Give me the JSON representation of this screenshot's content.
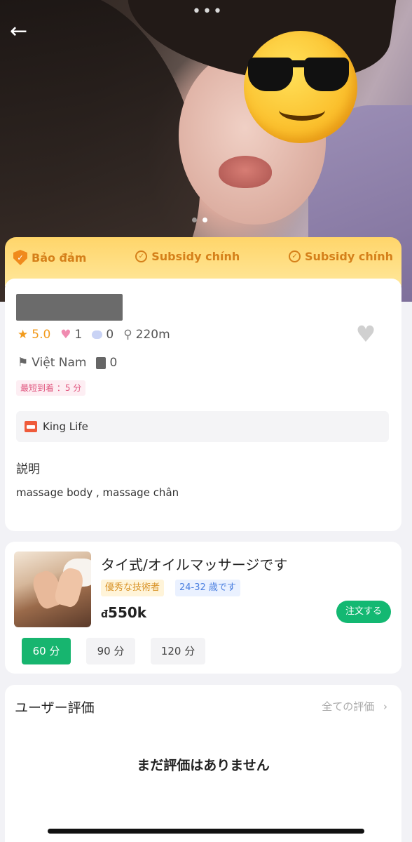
{
  "nav": {
    "back_icon": "←",
    "more_icon": "•••"
  },
  "guarantee": {
    "items": [
      {
        "label": "Bảo đảm"
      },
      {
        "label": "Subsidy chính"
      },
      {
        "label": "Subsidy chính"
      }
    ]
  },
  "profile": {
    "rating": "5.0",
    "likes": "1",
    "comments": "0",
    "distance": "220m",
    "country": "Việt Nam",
    "orders": "0",
    "arrival_tag": "最短到着 ：5 分",
    "shop_name": "King Life",
    "desc_title": "説明",
    "desc_text": "massage body , massage chân"
  },
  "service": {
    "title": "タイ式/オイルマッサージです",
    "tag_quality": "優秀な技術者",
    "tag_age": "24-32 歳です",
    "price_prefix": "đ",
    "price_value": "550k",
    "order_label": "注文する",
    "durations": [
      "60 分",
      "90 分",
      "120 分"
    ],
    "selected_duration": "60 分"
  },
  "reviews": {
    "title": "ユーザー評価",
    "all_label": "全ての評価",
    "empty_text": "まだ評価はありません"
  },
  "colors": {
    "accent_green": "#13b872",
    "guarantee_orange": "#d5801a",
    "rating_orange": "#f29b1d"
  }
}
